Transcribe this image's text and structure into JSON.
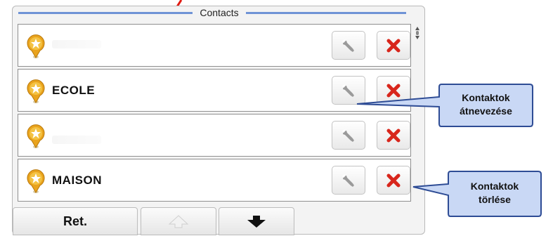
{
  "window": {
    "title": "Contacts"
  },
  "contacts": [
    {
      "name": "",
      "icon": "favorite-star-icon"
    },
    {
      "name": "ECOLE",
      "icon": "favorite-star-icon"
    },
    {
      "name": "",
      "icon": "favorite-star-icon"
    },
    {
      "name": "MAISON",
      "icon": "favorite-star-icon"
    }
  ],
  "row_actions": {
    "edit_icon": "wrench-icon",
    "delete_icon": "red-x-icon"
  },
  "bottom_bar": {
    "back_label": "Ret.",
    "up_icon": "arrow-up-icon",
    "down_icon": "arrow-down-icon"
  },
  "annotations": {
    "rename": "Kontaktok átnevezése",
    "rename_line1": "Kontaktok",
    "rename_line2": "átnevezése",
    "delete_line1": "Kontaktok",
    "delete_line2": "törlése"
  },
  "colors": {
    "accent": "#6f93d6",
    "delete": "#d8261c",
    "callout": "#c9d8f5",
    "arrow": "#e11b12"
  }
}
